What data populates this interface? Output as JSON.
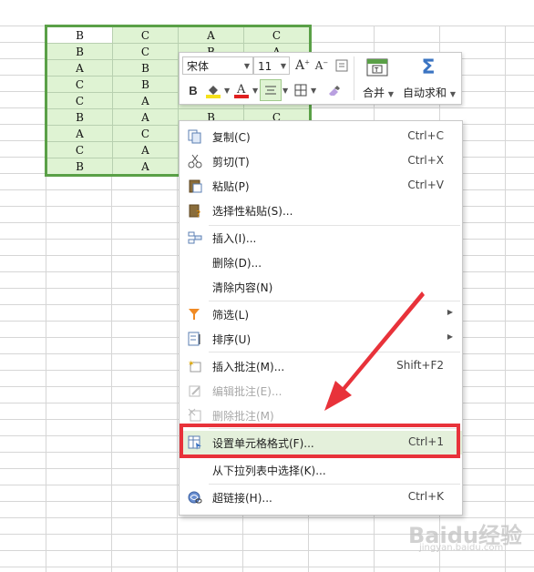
{
  "table": {
    "rows": [
      [
        "B",
        "C",
        "A",
        "C"
      ],
      [
        "B",
        "C",
        "B",
        "A"
      ],
      [
        "A",
        "B",
        "",
        ""
      ],
      [
        "C",
        "B",
        "",
        ""
      ],
      [
        "C",
        "A",
        "",
        ""
      ],
      [
        "B",
        "A",
        "B",
        "C"
      ],
      [
        "A",
        "C",
        "",
        ""
      ],
      [
        "C",
        "A",
        "",
        ""
      ],
      [
        "B",
        "A",
        "",
        ""
      ]
    ]
  },
  "toolbar": {
    "font_name": "宋体",
    "font_size": "11",
    "merge_label": "合并",
    "autosum_label": "自动求和"
  },
  "menu": {
    "copy": {
      "label": "复制(C)",
      "shortcut": "Ctrl+C"
    },
    "cut": {
      "label": "剪切(T)",
      "shortcut": "Ctrl+X"
    },
    "paste": {
      "label": "粘贴(P)",
      "shortcut": "Ctrl+V"
    },
    "paste_special": {
      "label": "选择性粘贴(S)..."
    },
    "insert": {
      "label": "插入(I)..."
    },
    "delete": {
      "label": "删除(D)..."
    },
    "clear": {
      "label": "清除内容(N)"
    },
    "filter": {
      "label": "筛选(L)"
    },
    "sort": {
      "label": "排序(U)"
    },
    "insert_comment": {
      "label": "插入批注(M)...",
      "shortcut": "Shift+F2"
    },
    "edit_comment": {
      "label": "编辑批注(E)..."
    },
    "delete_comment": {
      "label": "删除批注(M)"
    },
    "format_cells": {
      "label": "设置单元格格式(F)...",
      "shortcut": "Ctrl+1"
    },
    "pick_list": {
      "label": "从下拉列表中选择(K)..."
    },
    "hyperlink": {
      "label": "超链接(H)...",
      "shortcut": "Ctrl+K"
    }
  },
  "watermark": {
    "line1": "Baidu经验",
    "line2": "jingyan.baidu.com"
  },
  "colors": {
    "accent_red": "#e8323a",
    "selection_green": "#5aa047",
    "cell_fill": "#dff3d3",
    "font_color_bar": "#e02020",
    "highlight_bar": "#f5e11b"
  }
}
